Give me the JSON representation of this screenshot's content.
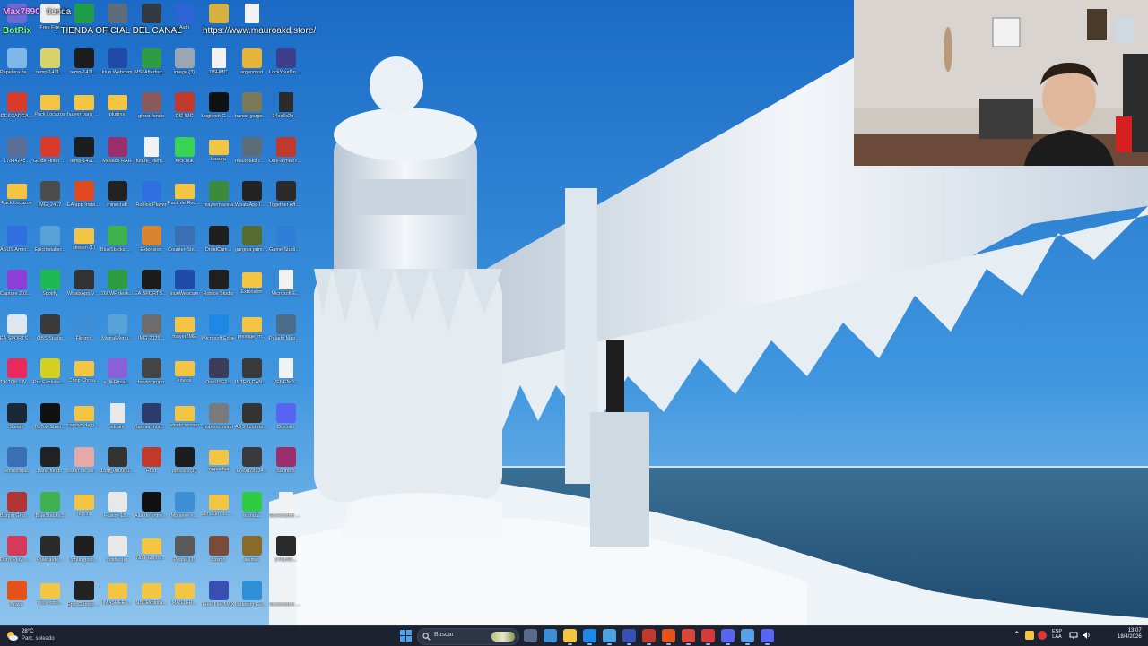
{
  "overlay": {
    "user": "Max7890",
    "message1": "tienda",
    "bot": "BotRix",
    "message2": ": TIENDA OFICIAL DEL CANAL",
    "url": "https://www.mauroakd.store/"
  },
  "desktop": {
    "icons": [
      {
        "label": "",
        "icon": "app-icon",
        "color": "#6b6bd6"
      },
      {
        "label": "Free Fire",
        "icon": "football-icon",
        "color": "#eeeeee"
      },
      {
        "label": "",
        "icon": "app-icon",
        "color": "#1e9c4a"
      },
      {
        "label": "",
        "icon": "app-icon",
        "color": "#5d6d7e"
      },
      {
        "label": "",
        "icon": "app-icon",
        "color": "#333a44"
      },
      {
        "label": "Auth",
        "icon": "app-icon",
        "color": "#2c64d6"
      },
      {
        "label": "",
        "icon": "app-icon",
        "color": "#d8b23e"
      },
      {
        "label": "",
        "icon": "file-icon",
        "color": "#f2f2f2"
      },
      {
        "label": "Papelera de reciclaje",
        "icon": "recycle-bin-icon",
        "color": "#7fb7e8"
      },
      {
        "label": "temp-1411...",
        "icon": "app-icon",
        "color": "#d9d26a"
      },
      {
        "label": "temp-1411...",
        "icon": "app-icon",
        "color": "#1d1d1d"
      },
      {
        "label": "Iriun Webcam",
        "icon": "app-icon",
        "color": "#1f4aa8"
      },
      {
        "label": "MSI Afterburner",
        "icon": "app-icon",
        "color": "#2f9b43"
      },
      {
        "label": "image (3)",
        "icon": "image-icon",
        "color": "#9aa6b2"
      },
      {
        "label": "DSHMC",
        "icon": "file-icon",
        "color": "#f2f2f2"
      },
      {
        "label": "argenmod",
        "icon": "app-icon",
        "color": "#e5b43a"
      },
      {
        "label": "LockYourDoor Demo",
        "icon": "app-icon",
        "color": "#3d3f8a"
      },
      {
        "label": "DESCARGA...",
        "icon": "pdf-icon",
        "color": "#d93a2a"
      },
      {
        "label": "Pack Locazos",
        "icon": "folder-icon",
        "color": "#f4c542"
      },
      {
        "label": "fauyer para negoel",
        "icon": "folder-icon",
        "color": "#f4c542"
      },
      {
        "label": "plugins",
        "icon": "folder-icon",
        "color": "#f4c542"
      },
      {
        "label": "ghost fondo",
        "icon": "image-icon",
        "color": "#8a5a5a"
      },
      {
        "label": "DSHMC",
        "icon": "app-icon",
        "color": "#c0392b"
      },
      {
        "label": "Logitech G HUB",
        "icon": "app-icon",
        "color": "#111111"
      },
      {
        "label": "banco gargolas",
        "icon": "image-icon",
        "color": "#7a7a58"
      },
      {
        "label": "34ec5c2b-...",
        "icon": "file-icon",
        "color": "#2b2b2b"
      },
      {
        "label": "1784424c...",
        "icon": "app-icon",
        "color": "#5b6e96"
      },
      {
        "label": "Guide Hitter Streams",
        "icon": "pdf-icon",
        "color": "#d93a2a"
      },
      {
        "label": "temp-1411...",
        "icon": "app-icon",
        "color": "#1d1d1d"
      },
      {
        "label": "Mosaco RAR",
        "icon": "app-icon",
        "color": "#9b2f6b"
      },
      {
        "label": "future_elem...",
        "icon": "file-icon",
        "color": "#f2f2f2"
      },
      {
        "label": "KickTalk",
        "icon": "app-icon",
        "color": "#39d353"
      },
      {
        "label": "basura",
        "icon": "folder-icon",
        "color": "#f4c542"
      },
      {
        "label": "mauroakd code",
        "icon": "image-icon",
        "color": "#5c6d7a"
      },
      {
        "label": "One-armed robber",
        "icon": "app-icon",
        "color": "#c0392b"
      },
      {
        "label": "Pack Locazos",
        "icon": "folder-icon",
        "color": "#f4c542"
      },
      {
        "label": "IMG_2417",
        "icon": "image-icon",
        "color": "#4c4c4c"
      },
      {
        "label": "EA app Instalar",
        "icon": "app-icon",
        "color": "#e04a1f"
      },
      {
        "label": "minecraft",
        "icon": "app-icon",
        "color": "#222222"
      },
      {
        "label": "Roblox Player",
        "icon": "app-icon",
        "color": "#2f6fe0"
      },
      {
        "label": "Pack de Recursos ...",
        "icon": "folder-icon",
        "color": "#f4c542"
      },
      {
        "label": "mayermaceta",
        "icon": "image-icon",
        "color": "#3c8a3c"
      },
      {
        "label": "WhatsApp Image 2025...",
        "icon": "image-icon",
        "color": "#222222"
      },
      {
        "label": "Together After Dark",
        "icon": "app-icon",
        "color": "#2b2b2b"
      },
      {
        "label": "ASUS Armoury...",
        "icon": "app-icon",
        "color": "#2f6fe0"
      },
      {
        "label": "EpicInstaller...",
        "icon": "app-icon",
        "color": "#57a2d8"
      },
      {
        "label": "stream (1)",
        "icon": "folder-icon",
        "color": "#f4c542"
      },
      {
        "label": "BlueStacks Multi-Insta...",
        "icon": "app-icon",
        "color": "#3fb24f"
      },
      {
        "label": "Extension",
        "icon": "app-icon",
        "color": "#d9852f"
      },
      {
        "label": "Counter-Strike 2",
        "icon": "app-icon",
        "color": "#3a6fb3"
      },
      {
        "label": "DroidCam...",
        "icon": "app-icon",
        "color": "#1f1f1f"
      },
      {
        "label": "gargola primer ...",
        "icon": "image-icon",
        "color": "#556b2f"
      },
      {
        "label": "Game Studio Installer",
        "icon": "app-icon",
        "color": "#2f7fd6"
      },
      {
        "label": "Capture 2025...",
        "icon": "app-icon",
        "color": "#8b3fd6"
      },
      {
        "label": "Spotify",
        "icon": "app-icon",
        "color": "#1db954"
      },
      {
        "label": "WhatsApp Video 2025-...",
        "icon": "image-icon",
        "color": "#333333"
      },
      {
        "label": "260WF desk...",
        "icon": "app-icon",
        "color": "#2f9b43"
      },
      {
        "label": "EA SPORTS FC 24",
        "icon": "app-icon",
        "color": "#1b1b1b"
      },
      {
        "label": "lriunWebcam",
        "icon": "app-icon",
        "color": "#1f4aa8"
      },
      {
        "label": "Roblox Studio",
        "icon": "app-icon",
        "color": "#202020"
      },
      {
        "label": "Extension",
        "icon": "folder-icon",
        "color": "#f4c542"
      },
      {
        "label": "Microsoft E...",
        "icon": "file-icon",
        "color": "#f2f2f2"
      },
      {
        "label": "EA SPORTS FC 26",
        "icon": "app-icon",
        "color": "#dfe6ee"
      },
      {
        "label": "OBS Studio",
        "icon": "app-icon",
        "color": "#3a3a3a"
      },
      {
        "label": "Flipgrid",
        "icon": "app-icon",
        "color": "#3f8fd6"
      },
      {
        "label": "MistralMenu...",
        "icon": "app-icon",
        "color": "#57a2d8"
      },
      {
        "label": "IMG-2025...",
        "icon": "image-icon",
        "color": "#6c6c6c"
      },
      {
        "label": "fnayer2ME",
        "icon": "folder-icon",
        "color": "#f4c542"
      },
      {
        "label": "Microsoft Edge",
        "icon": "app-icon",
        "color": "#1e88e5"
      },
      {
        "label": "prestige_m...",
        "icon": "folder-icon",
        "color": "#f4c542"
      },
      {
        "label": "Pelado Mapper",
        "icon": "image-icon",
        "color": "#4a6e8a"
      },
      {
        "label": "TIKTOK LIVE Studio",
        "icon": "app-icon",
        "color": "#e82b5c"
      },
      {
        "label": "Pro Evolution Soccer 6",
        "icon": "app-icon",
        "color": "#d8d020"
      },
      {
        "label": "Chop Chrsa...",
        "icon": "folder-icon",
        "color": "#f4c542"
      },
      {
        "label": "e_likRitual...",
        "icon": "app-icon",
        "color": "#8b5fd6"
      },
      {
        "label": "fondo grupo",
        "icon": "image-icon",
        "color": "#444444"
      },
      {
        "label": "envios",
        "icon": "folder-icon",
        "color": "#f4c542"
      },
      {
        "label": "OneUSF1...",
        "icon": "image-icon",
        "color": "#3d3d5a"
      },
      {
        "label": "INTRO CANCION",
        "icon": "image-icon",
        "color": "#3a3a3a"
      },
      {
        "label": "VENENO...",
        "icon": "file-icon",
        "color": "#f2f2f2"
      },
      {
        "label": "Steam",
        "icon": "app-icon",
        "color": "#1b2838"
      },
      {
        "label": "TikTok Stem...",
        "icon": "app-icon",
        "color": "#111111"
      },
      {
        "label": "cambio de gargolas",
        "icon": "folder-icon",
        "color": "#f4c542"
      },
      {
        "label": "sdcam",
        "icon": "file-icon",
        "color": "#e8e8e8"
      },
      {
        "label": "Banner modelo",
        "icon": "image-icon",
        "color": "#2b3b6a"
      },
      {
        "label": "efecto sonido",
        "icon": "folder-icon",
        "color": "#f4c542"
      },
      {
        "label": "marcos fondo",
        "icon": "image-icon",
        "color": "#7a7a7a"
      },
      {
        "label": "ASS Informacion",
        "icon": "app-icon",
        "color": "#333333"
      },
      {
        "label": "Discord",
        "icon": "app-icon",
        "color": "#5865f2"
      },
      {
        "label": "entrevistas",
        "icon": "image-icon",
        "color": "#3a6fb3"
      },
      {
        "label": "bana fondo",
        "icon": "image-icon",
        "color": "#222222"
      },
      {
        "label": "salon de verdad",
        "icon": "image-icon",
        "color": "#e8a8a8"
      },
      {
        "label": "1fdg_000000...",
        "icon": "image-icon",
        "color": "#333333"
      },
      {
        "label": "Rust",
        "icon": "app-icon",
        "color": "#c0392b"
      },
      {
        "label": "pelicula (1)",
        "icon": "image-icon",
        "color": "#1d1d1d"
      },
      {
        "label": "mapashar",
        "icon": "folder-icon",
        "color": "#f4c542"
      },
      {
        "label": "17e9b78934...",
        "icon": "image-icon",
        "color": "#3a3a3a"
      },
      {
        "label": "Banners",
        "icon": "app-icon",
        "color": "#9b2f6b"
      },
      {
        "label": "Burgin Gnomes",
        "icon": "app-icon",
        "color": "#b33232"
      },
      {
        "label": "BlueStacks 5",
        "icon": "app-icon",
        "color": "#3fb24f"
      },
      {
        "label": "remini",
        "icon": "folder-icon",
        "color": "#f4c542"
      },
      {
        "label": "Fusion-18...",
        "icon": "app-icon",
        "color": "#e8e8e8"
      },
      {
        "label": "Alta de entregas",
        "icon": "app-icon",
        "color": "#111111"
      },
      {
        "label": "Mplayer-X...",
        "icon": "app-icon",
        "color": "#3f8fd6"
      },
      {
        "label": "almacen de RAVMOB...",
        "icon": "folder-icon",
        "color": "#f4c542"
      },
      {
        "label": "entrada",
        "icon": "app-icon",
        "color": "#2ecc40"
      },
      {
        "label": "Screenshot 2025-02-...",
        "icon": "file-icon",
        "color": "#f2f2f2"
      },
      {
        "label": "Don't Play This Demo",
        "icon": "app-icon",
        "color": "#d63a5a"
      },
      {
        "label": "Rueda-de...",
        "icon": "image-icon",
        "color": "#2b2b2b"
      },
      {
        "label": "lghub_inst...",
        "icon": "app-icon",
        "color": "#1f1f1f"
      },
      {
        "label": "notifier.jar",
        "icon": "app-icon",
        "color": "#e8e8e8"
      },
      {
        "label": "NBT Splora...",
        "icon": "folder-icon",
        "color": "#f4c542"
      },
      {
        "label": "Peque (1)",
        "icon": "image-icon",
        "color": "#5a5a5a"
      },
      {
        "label": "cosmo",
        "icon": "image-icon",
        "color": "#7a4a3a"
      },
      {
        "label": "alertas",
        "icon": "image-icon",
        "color": "#8a6a2a"
      },
      {
        "label": "17f1c90...",
        "icon": "image-icon",
        "color": "#2a2a2a"
      },
      {
        "label": "Brave",
        "icon": "app-icon",
        "color": "#e2541b"
      },
      {
        "label": "mdiv-ptto...",
        "icon": "folder-icon",
        "color": "#f4c542"
      },
      {
        "label": "Epic Games Launcher",
        "icon": "app-icon",
        "color": "#222222"
      },
      {
        "label": "IMASHEET...",
        "icon": "folder-icon",
        "color": "#f4c542"
      },
      {
        "label": "NBTExplora...",
        "icon": "folder-icon",
        "color": "#f4c542"
      },
      {
        "label": "MASTER...",
        "icon": "folder-icon",
        "color": "#f4c542"
      },
      {
        "label": "Free Fire MAX",
        "icon": "app-icon",
        "color": "#3a4fb3"
      },
      {
        "label": "Lettering Generator...",
        "icon": "app-icon",
        "color": "#2f8fd6"
      },
      {
        "label": "Screenshot 2025-02-...",
        "icon": "file-icon",
        "color": "#f2f2f2"
      }
    ]
  },
  "taskbar": {
    "weather": {
      "temp": "28°C",
      "condition": "Parc. soleado"
    },
    "search_placeholder": "Buscar",
    "apps": [
      {
        "name": "task-view",
        "color": "#5a6a8a"
      },
      {
        "name": "widgets",
        "color": "#3f8fd6"
      },
      {
        "name": "file-explorer",
        "color": "#f4c542"
      },
      {
        "name": "edge",
        "color": "#1e88e5"
      },
      {
        "name": "notepad",
        "color": "#4aa3df"
      },
      {
        "name": "fe-app",
        "color": "#3a4fb3"
      },
      {
        "name": "msi-app",
        "color": "#c0392b"
      },
      {
        "name": "brave",
        "color": "#e2541b"
      },
      {
        "name": "chrome",
        "color": "#d9453b"
      },
      {
        "name": "recorder",
        "color": "#d63a3a"
      },
      {
        "name": "discord-tb",
        "color": "#5865f2"
      },
      {
        "name": "check-app",
        "color": "#5aa0e8"
      },
      {
        "name": "discord",
        "color": "#5865f2"
      }
    ],
    "tray": {
      "lang_line1": "ESP",
      "lang_line2": "LAA",
      "time": "13:07",
      "date": "18/4/2026"
    }
  }
}
